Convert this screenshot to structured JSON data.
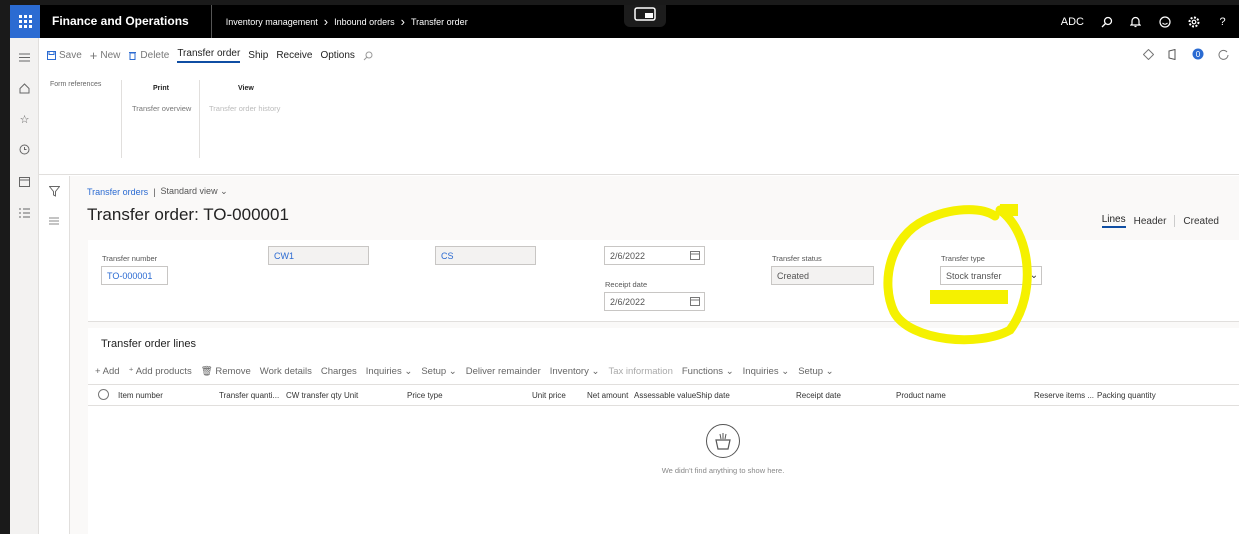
{
  "topbar": {
    "app_name": "Finance and Operations",
    "breadcrumb": [
      "Inventory management",
      "Inbound orders",
      "Transfer order"
    ],
    "company": "ADC"
  },
  "actions": {
    "save": "Save",
    "new": "New",
    "delete": "Delete",
    "transfer_order": "Transfer order",
    "ship": "Ship",
    "receive": "Receive",
    "options": "Options"
  },
  "action_groups": {
    "form_references": "Form references",
    "print_head": "Print",
    "transfer_overview": "Transfer overview",
    "view_head": "View",
    "transfer_order_history": "Transfer order history"
  },
  "page": {
    "breadcrumb_link": "Transfer orders",
    "view_name": "Standard view",
    "title": "Transfer order: TO-000001",
    "tabs": {
      "lines": "Lines",
      "header": "Header",
      "created": "Created"
    }
  },
  "header": {
    "transfer_number_label": "Transfer number",
    "transfer_number": "TO-000001",
    "from_warehouse": "CW1",
    "to_warehouse": "CS",
    "ship_date": "2/6/2022",
    "receipt_date_label": "Receipt date",
    "receipt_date": "2/6/2022",
    "transfer_status_label": "Transfer status",
    "transfer_status": "Created",
    "transfer_type_label": "Transfer type",
    "transfer_type": "Stock transfer"
  },
  "lines": {
    "title": "Transfer order lines",
    "toolbar": {
      "add": "Add",
      "add_products": "Add products",
      "remove": "Remove",
      "work_details": "Work details",
      "charges": "Charges",
      "inquiries": "Inquiries",
      "setup": "Setup",
      "deliver_remainder": "Deliver remainder",
      "inventory": "Inventory",
      "tax_information": "Tax information",
      "functions": "Functions",
      "inquiries2": "Inquiries",
      "setup2": "Setup"
    },
    "columns": {
      "item_number": "Item number",
      "transfer_quantity": "Transfer quanti...",
      "cw_transfer_qty": "CW transfer qty",
      "unit": "Unit",
      "price_type": "Price type",
      "unit_price": "Unit price",
      "net_amount": "Net amount",
      "assessable_value": "Assessable value",
      "ship_date": "Ship date",
      "receipt_date": "Receipt date",
      "product_name": "Product name",
      "reserve_items": "Reserve items ...",
      "packing_quantity": "Packing quantity"
    },
    "empty_message": "We didn't find anything to show here."
  },
  "colors": {
    "accent": "#0f4ea3",
    "waffle": "#2b6bd2",
    "highlight": "#f5f100"
  }
}
